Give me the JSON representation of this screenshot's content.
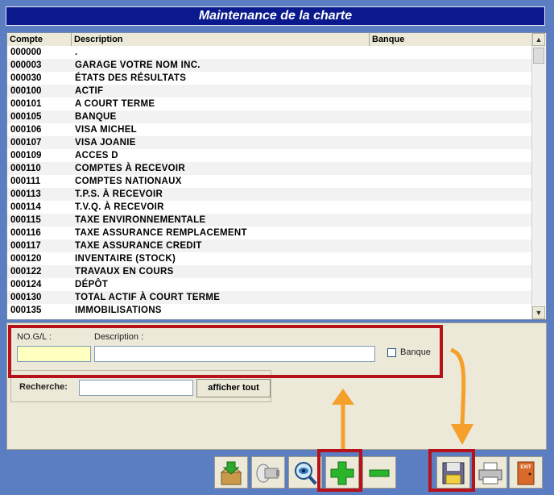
{
  "window": {
    "title": "Maintenance de la charte"
  },
  "grid": {
    "columns": [
      "Compte",
      "Description",
      "Banque"
    ],
    "rows": [
      [
        "000000",
        "."
      ],
      [
        "000003",
        "GARAGE VOTRE NOM INC."
      ],
      [
        "000030",
        "ÉTATS DES RÉSULTATS"
      ],
      [
        "000100",
        "ACTIF"
      ],
      [
        "000101",
        "A COURT TERME"
      ],
      [
        "000105",
        "BANQUE"
      ],
      [
        "000106",
        "VISA MICHEL"
      ],
      [
        "000107",
        "VISA JOANIE"
      ],
      [
        "000109",
        "ACCES D"
      ],
      [
        "000110",
        "COMPTES À RECEVOIR"
      ],
      [
        "000111",
        "COMPTES NATIONAUX"
      ],
      [
        "000113",
        "T.P.S. À RECEVOIR"
      ],
      [
        "000114",
        "T.V.Q. À RECEVOIR"
      ],
      [
        "000115",
        "TAXE ENVIRONNEMENTALE"
      ],
      [
        "000116",
        "TAXE ASSURANCE REMPLACEMENT"
      ],
      [
        "000117",
        "TAXE ASSURANCE CREDIT"
      ],
      [
        "000120",
        "INVENTAIRE (STOCK)"
      ],
      [
        "000122",
        "TRAVAUX EN COURS"
      ],
      [
        "000124",
        "DÉPÔT"
      ],
      [
        "000130",
        "TOTAL ACTIF À COURT TERME"
      ],
      [
        "000135",
        "IMMOBILISATIONS"
      ]
    ]
  },
  "form": {
    "gl_label": "NO.G/L :",
    "gl_value": "",
    "description_label": "Description :",
    "description_value": "",
    "banque_label": "Banque",
    "banque_checked": false,
    "search_label": "Recherche:",
    "search_value": "",
    "show_all_label": "afficher tout"
  },
  "toolbar": {
    "icons": [
      "import-icon",
      "flashlight-icon",
      "view-icon",
      "add-icon",
      "remove-icon",
      "save-icon",
      "print-icon",
      "exit-icon"
    ],
    "exit_label": "EXIT"
  },
  "colors": {
    "title_bg": "#0a1a8c",
    "highlight": "#b5121b",
    "arrow": "#f4a02a",
    "gl_field_bg": "#ffffc0",
    "add_green": "#2bb52b"
  }
}
